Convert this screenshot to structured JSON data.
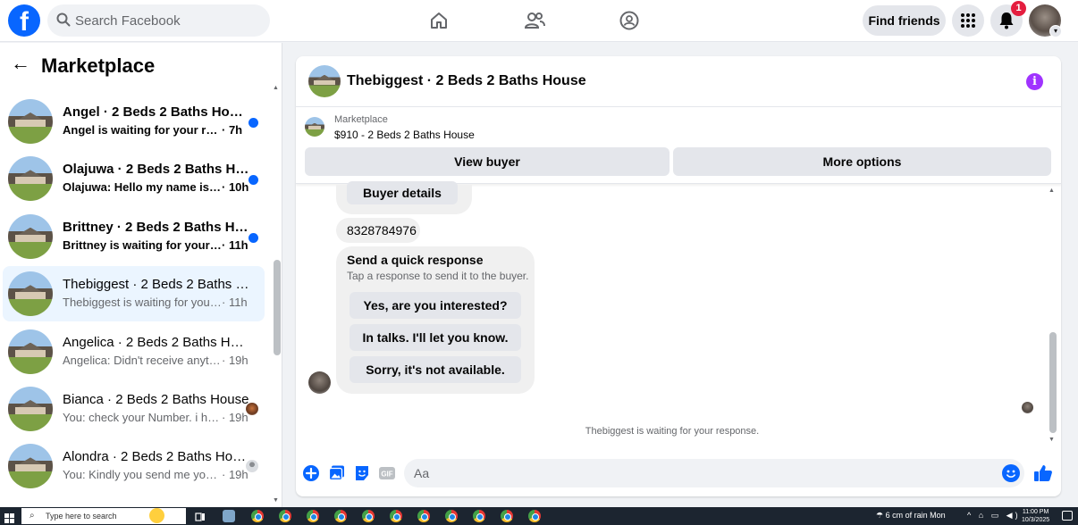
{
  "topbar": {
    "logo": "f",
    "search_placeholder": "Search Facebook",
    "find_friends_label": "Find friends",
    "notification_count": "1",
    "nav_icons": [
      "home-icon",
      "friends-icon",
      "groups-icon"
    ],
    "icons": [
      "search-icon",
      "menu-grid-icon",
      "bell-icon",
      "avatar-chevron-icon"
    ]
  },
  "sidebar": {
    "title": "Marketplace",
    "conversations": [
      {
        "title": "Angel · 2 Beds 2 Baths House",
        "preview": "Angel is waiting for your respon...",
        "time": "· 7h",
        "unread": true
      },
      {
        "title": "Olajuwa · 2 Beds 2 Baths House",
        "preview": "Olajuwa: Hello my name is Olaj...",
        "time": "· 10h",
        "unread": true
      },
      {
        "title": "Brittney · 2 Beds 2 Baths House",
        "preview": "Brittney is waiting for your res...",
        "time": "· 11h",
        "unread": true
      },
      {
        "title": "Thebiggest · 2 Beds 2 Baths Hou...",
        "preview": "Thebiggest is waiting for your res...",
        "time": "· 11h",
        "unread": false,
        "active": true
      },
      {
        "title": "Angelica · 2 Beds 2 Baths House",
        "preview": "Angelica: Didn't receive anything",
        "time": "· 19h",
        "unread": false
      },
      {
        "title": "Bianca · 2 Beds 2 Baths House",
        "preview": "You: check your Number. i hav...",
        "time": "· 19h",
        "unread": false
      },
      {
        "title": "Alondra · 2 Beds 2 Baths House",
        "preview": "You: Kindly you send me your n...",
        "time": "· 19h",
        "unread": false
      }
    ]
  },
  "chat": {
    "title": "Thebiggest · 2 Beds 2 Baths House",
    "marketplace_label": "Marketplace",
    "listing": "$910 - 2 Beds 2 Baths House",
    "view_buyer_label": "View buyer",
    "more_options_label": "More options",
    "buyer_details_label": "Buyer details",
    "phone_number": "8328784976",
    "quick_response_title": "Send a quick response",
    "quick_response_subtitle": "Tap a response to send it to the buyer.",
    "quick_responses": [
      "Yes, are you interested?",
      "In talks. I'll let you know.",
      "Sorry, it's not available."
    ],
    "waiting_text": "Thebiggest is waiting for your response.",
    "composer_placeholder": "Aa",
    "composer_icons": [
      "plus-circle-icon",
      "photo-icon",
      "sticker-icon",
      "gif-icon",
      "emoji-icon",
      "like-icon"
    ]
  },
  "taskbar": {
    "search_placeholder": "Type here to search",
    "weather": "6 cm of rain Mon",
    "time": "11:00 PM",
    "date": "10/3/2025"
  },
  "colors": {
    "brand_blue": "#0866ff",
    "unread_dot": "#0866ff",
    "info_purple": "#a033ff",
    "badge_red": "#e41e3f",
    "active_row": "#ebf5ff"
  }
}
